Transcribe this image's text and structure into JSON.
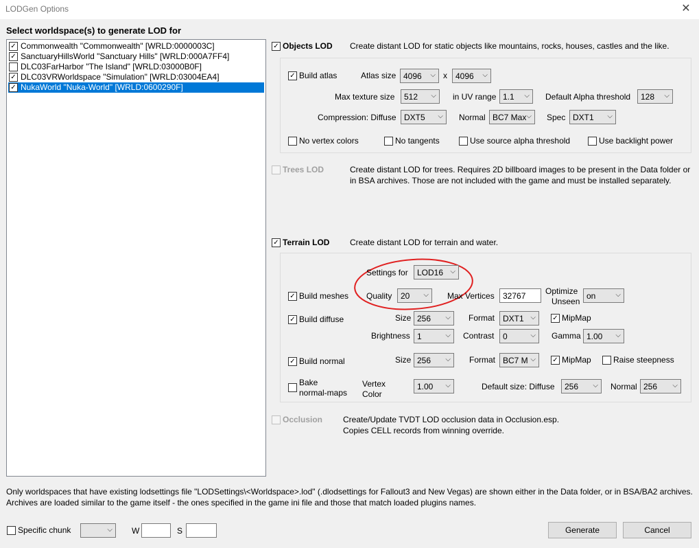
{
  "window": {
    "title": "LODGen Options",
    "close_glyph": "✕"
  },
  "worldspace": {
    "header": "Select worldspace(s) to generate LOD for",
    "items": [
      {
        "label": "Commonwealth \"Commonwealth\" [WRLD:0000003C]",
        "checked": true
      },
      {
        "label": "SanctuaryHillsWorld \"Sanctuary Hills\" [WRLD:000A7FF4]",
        "checked": true
      },
      {
        "label": "DLC03FarHarbor \"The Island\" [WRLD:03000B0F]",
        "checked": false
      },
      {
        "label": "DLC03VRWorldspace \"Simulation\" [WRLD:03004EA4]",
        "checked": true
      },
      {
        "label": "NukaWorld \"Nuka-World\" [WRLD:0600290F]",
        "checked": true,
        "selected": true
      }
    ]
  },
  "objects": {
    "label": "Objects LOD",
    "desc": "Create distant LOD for static objects like mountains, rocks, houses, castles and the like.",
    "build_atlas": "Build atlas",
    "atlas_size_label": "Atlas size",
    "atlas_w": "4096",
    "x_label": "x",
    "atlas_h": "4096",
    "max_tex_label": "Max texture size",
    "max_tex": "512",
    "uv_label": "in UV range",
    "uv": "1.1",
    "alpha_label": "Default Alpha threshold",
    "alpha": "128",
    "comp_label": "Compression: Diffuse",
    "diffuse": "DXT5",
    "normal_label": "Normal",
    "normal": "BC7 Max",
    "spec_label": "Spec",
    "spec": "DXT1",
    "no_vertex": "No vertex colors",
    "no_tangents": "No tangents",
    "use_alpha": "Use source alpha threshold",
    "use_backlight": "Use backlight power"
  },
  "trees": {
    "label": "Trees LOD",
    "desc1": "Create distant LOD for trees. Requires 2D billboard images to be present in the Data folder or",
    "desc2": "in BSA archives. Those are not included with the game and must be installed separately."
  },
  "terrain": {
    "label": "Terrain LOD",
    "desc": "Create distant LOD for terrain and water.",
    "settings_for_label": "Settings for",
    "settings_for": "LOD16",
    "build_meshes": "Build meshes",
    "quality_label": "Quality",
    "quality": "20",
    "max_vert_label": "Max Vertices",
    "max_vert": "32767",
    "optimize_label1": "Optimize",
    "optimize_label2": "Unseen",
    "optimize": "on",
    "build_diffuse": "Build diffuse",
    "size_label": "Size",
    "diff_size": "256",
    "format_label": "Format",
    "diff_format": "DXT1",
    "mipmap": "MipMap",
    "brightness_label": "Brightness",
    "brightness": "1",
    "contrast_label": "Contrast",
    "contrast": "0",
    "gamma_label": "Gamma",
    "gamma": "1.00",
    "build_normal": "Build normal",
    "norm_size": "256",
    "norm_format": "BC7 M",
    "raise_steep": "Raise steepness",
    "bake1": "Bake",
    "bake2": "normal-maps",
    "vc1": "Vertex",
    "vc2": "Color",
    "vc_value": "1.00",
    "default_size_label": "Default size: Diffuse",
    "default_diffuse": "256",
    "default_normal_label": "Normal",
    "default_normal": "256"
  },
  "occlusion": {
    "label": "Occlusion",
    "desc1": "Create/Update TVDT LOD occlusion data in Occlusion.esp.",
    "desc2": "Copies CELL records from winning override."
  },
  "footer": {
    "line1": "Only worldspaces that have existing lodsettings file \"LODSettings\\<Worldspace>.lod\" (.dlodsettings for Fallout3 and New Vegas) are shown either in the Data folder, or in BSA/BA2 archives.",
    "line2": "Archives are loaded similar to the game itself - the ones specified in the game ini file and those that match loaded plugins names."
  },
  "bottom": {
    "specific_chunk": "Specific chunk",
    "w_label": "W",
    "s_label": "S",
    "generate": "Generate",
    "cancel": "Cancel"
  },
  "check_glyph": "✓",
  "arrow_glyph": "⌵"
}
